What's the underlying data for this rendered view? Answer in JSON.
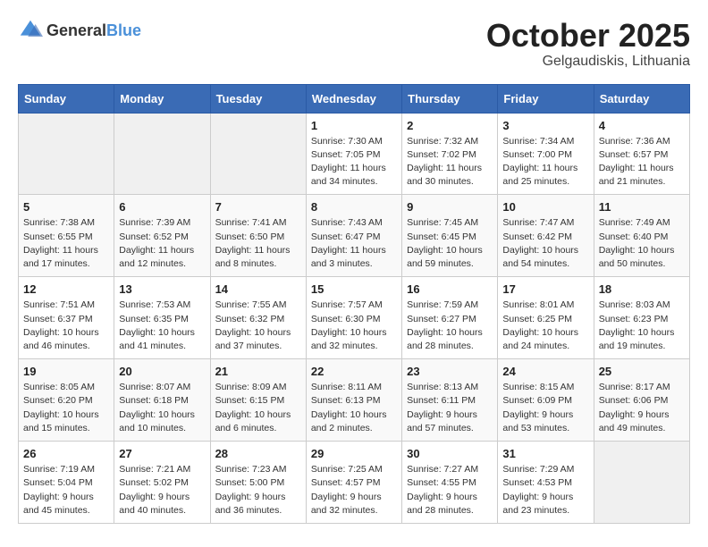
{
  "header": {
    "logo_general": "General",
    "logo_blue": "Blue",
    "month": "October 2025",
    "location": "Gelgaudiskis, Lithuania"
  },
  "weekdays": [
    "Sunday",
    "Monday",
    "Tuesday",
    "Wednesday",
    "Thursday",
    "Friday",
    "Saturday"
  ],
  "weeks": [
    [
      {
        "day": "",
        "info": ""
      },
      {
        "day": "",
        "info": ""
      },
      {
        "day": "",
        "info": ""
      },
      {
        "day": "1",
        "info": "Sunrise: 7:30 AM\nSunset: 7:05 PM\nDaylight: 11 hours\nand 34 minutes."
      },
      {
        "day": "2",
        "info": "Sunrise: 7:32 AM\nSunset: 7:02 PM\nDaylight: 11 hours\nand 30 minutes."
      },
      {
        "day": "3",
        "info": "Sunrise: 7:34 AM\nSunset: 7:00 PM\nDaylight: 11 hours\nand 25 minutes."
      },
      {
        "day": "4",
        "info": "Sunrise: 7:36 AM\nSunset: 6:57 PM\nDaylight: 11 hours\nand 21 minutes."
      }
    ],
    [
      {
        "day": "5",
        "info": "Sunrise: 7:38 AM\nSunset: 6:55 PM\nDaylight: 11 hours\nand 17 minutes."
      },
      {
        "day": "6",
        "info": "Sunrise: 7:39 AM\nSunset: 6:52 PM\nDaylight: 11 hours\nand 12 minutes."
      },
      {
        "day": "7",
        "info": "Sunrise: 7:41 AM\nSunset: 6:50 PM\nDaylight: 11 hours\nand 8 minutes."
      },
      {
        "day": "8",
        "info": "Sunrise: 7:43 AM\nSunset: 6:47 PM\nDaylight: 11 hours\nand 3 minutes."
      },
      {
        "day": "9",
        "info": "Sunrise: 7:45 AM\nSunset: 6:45 PM\nDaylight: 10 hours\nand 59 minutes."
      },
      {
        "day": "10",
        "info": "Sunrise: 7:47 AM\nSunset: 6:42 PM\nDaylight: 10 hours\nand 54 minutes."
      },
      {
        "day": "11",
        "info": "Sunrise: 7:49 AM\nSunset: 6:40 PM\nDaylight: 10 hours\nand 50 minutes."
      }
    ],
    [
      {
        "day": "12",
        "info": "Sunrise: 7:51 AM\nSunset: 6:37 PM\nDaylight: 10 hours\nand 46 minutes."
      },
      {
        "day": "13",
        "info": "Sunrise: 7:53 AM\nSunset: 6:35 PM\nDaylight: 10 hours\nand 41 minutes."
      },
      {
        "day": "14",
        "info": "Sunrise: 7:55 AM\nSunset: 6:32 PM\nDaylight: 10 hours\nand 37 minutes."
      },
      {
        "day": "15",
        "info": "Sunrise: 7:57 AM\nSunset: 6:30 PM\nDaylight: 10 hours\nand 32 minutes."
      },
      {
        "day": "16",
        "info": "Sunrise: 7:59 AM\nSunset: 6:27 PM\nDaylight: 10 hours\nand 28 minutes."
      },
      {
        "day": "17",
        "info": "Sunrise: 8:01 AM\nSunset: 6:25 PM\nDaylight: 10 hours\nand 24 minutes."
      },
      {
        "day": "18",
        "info": "Sunrise: 8:03 AM\nSunset: 6:23 PM\nDaylight: 10 hours\nand 19 minutes."
      }
    ],
    [
      {
        "day": "19",
        "info": "Sunrise: 8:05 AM\nSunset: 6:20 PM\nDaylight: 10 hours\nand 15 minutes."
      },
      {
        "day": "20",
        "info": "Sunrise: 8:07 AM\nSunset: 6:18 PM\nDaylight: 10 hours\nand 10 minutes."
      },
      {
        "day": "21",
        "info": "Sunrise: 8:09 AM\nSunset: 6:15 PM\nDaylight: 10 hours\nand 6 minutes."
      },
      {
        "day": "22",
        "info": "Sunrise: 8:11 AM\nSunset: 6:13 PM\nDaylight: 10 hours\nand 2 minutes."
      },
      {
        "day": "23",
        "info": "Sunrise: 8:13 AM\nSunset: 6:11 PM\nDaylight: 9 hours\nand 57 minutes."
      },
      {
        "day": "24",
        "info": "Sunrise: 8:15 AM\nSunset: 6:09 PM\nDaylight: 9 hours\nand 53 minutes."
      },
      {
        "day": "25",
        "info": "Sunrise: 8:17 AM\nSunset: 6:06 PM\nDaylight: 9 hours\nand 49 minutes."
      }
    ],
    [
      {
        "day": "26",
        "info": "Sunrise: 7:19 AM\nSunset: 5:04 PM\nDaylight: 9 hours\nand 45 minutes."
      },
      {
        "day": "27",
        "info": "Sunrise: 7:21 AM\nSunset: 5:02 PM\nDaylight: 9 hours\nand 40 minutes."
      },
      {
        "day": "28",
        "info": "Sunrise: 7:23 AM\nSunset: 5:00 PM\nDaylight: 9 hours\nand 36 minutes."
      },
      {
        "day": "29",
        "info": "Sunrise: 7:25 AM\nSunset: 4:57 PM\nDaylight: 9 hours\nand 32 minutes."
      },
      {
        "day": "30",
        "info": "Sunrise: 7:27 AM\nSunset: 4:55 PM\nDaylight: 9 hours\nand 28 minutes."
      },
      {
        "day": "31",
        "info": "Sunrise: 7:29 AM\nSunset: 4:53 PM\nDaylight: 9 hours\nand 23 minutes."
      },
      {
        "day": "",
        "info": ""
      }
    ]
  ]
}
